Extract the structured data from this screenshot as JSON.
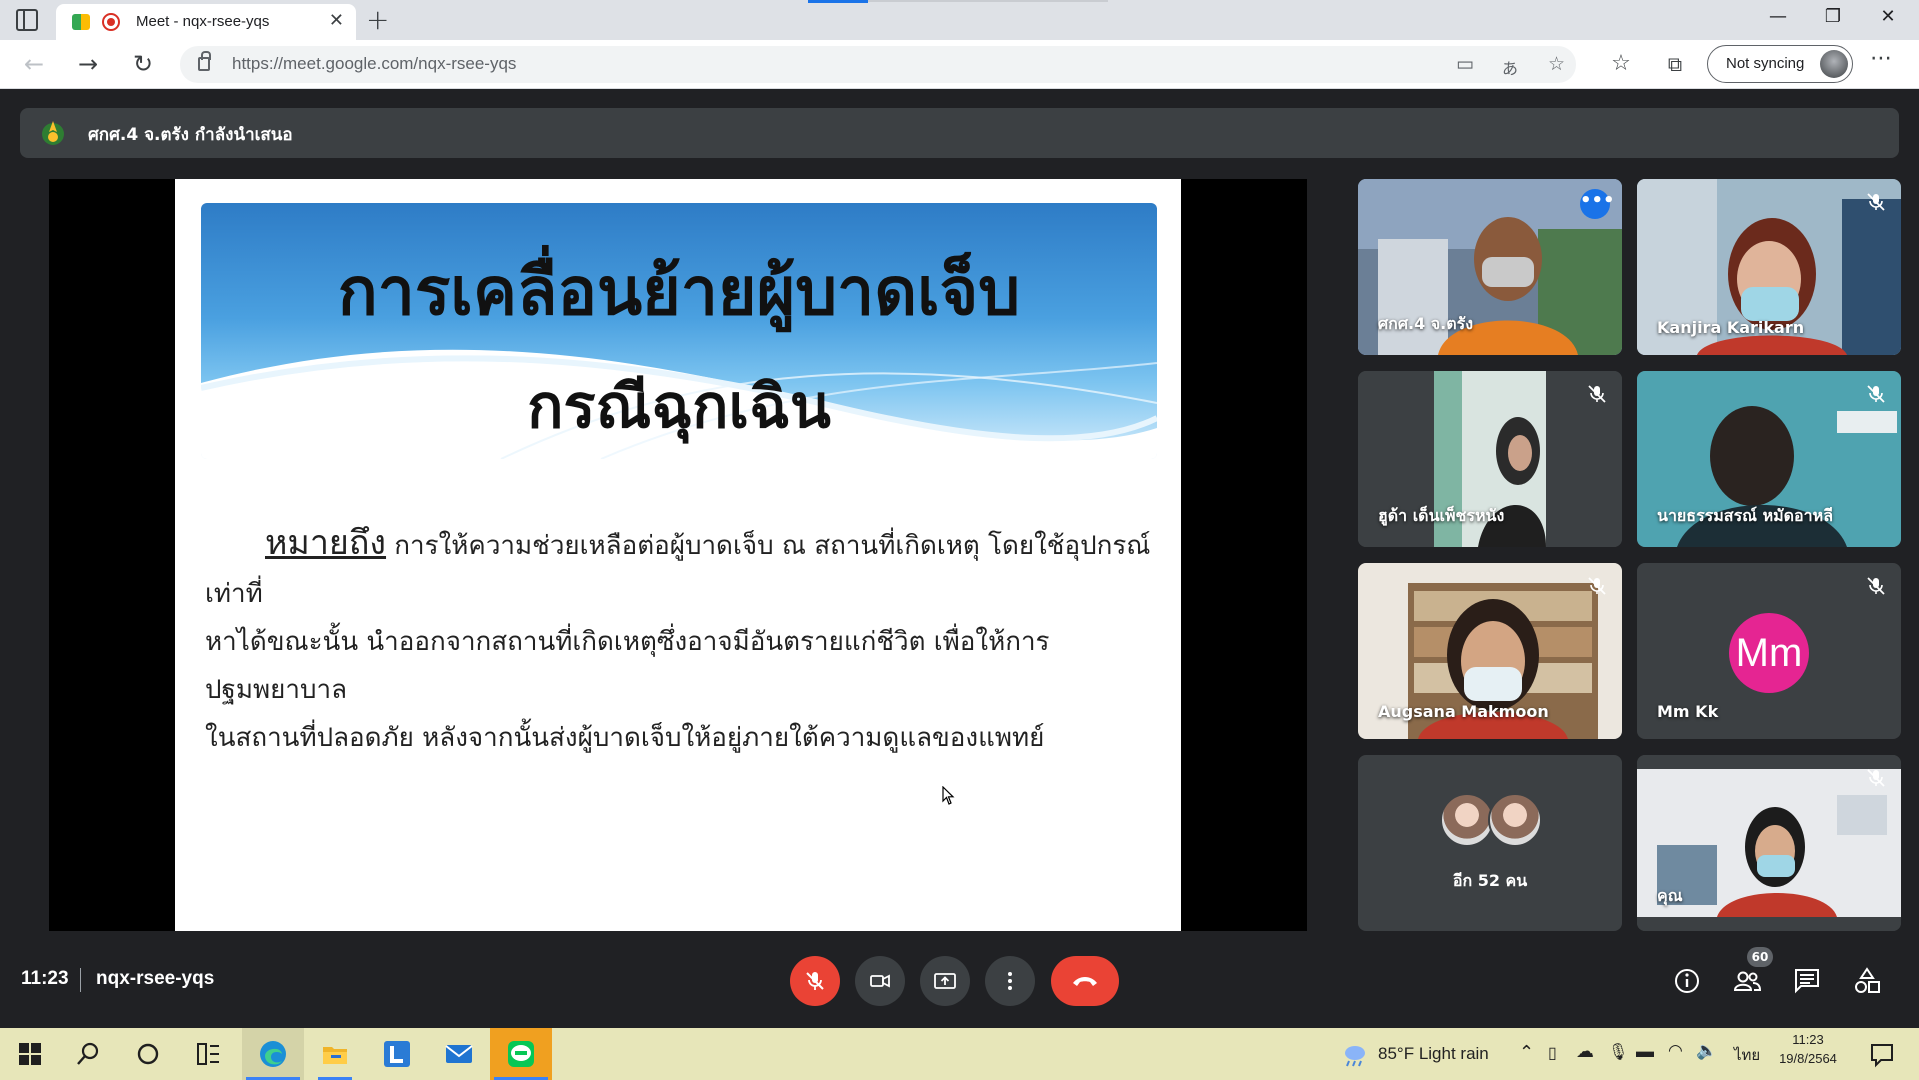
{
  "browser": {
    "tab_title": "Meet - nqx-rsee-yqs",
    "url": "https://meet.google.com/nqx-rsee-yqs",
    "sync_label": "Not syncing"
  },
  "meet": {
    "presenting_text": "ศกศ.4 จ.ตรัง กำลังนำเสนอ",
    "slide": {
      "title_line1": "การเคลื่อนย้ายผู้บาดเจ็บ",
      "title_line2": "กรณีฉุกเฉิน",
      "lead_word": "หมายถึง",
      "body_line1": " การให้ความช่วยเหลือต่อผู้บาดเจ็บ ณ สถานที่เกิดเหตุ โดยใช้อุปกรณ์เท่าที่",
      "body_line2": "หาได้ขณะนั้น นำออกจากสถานที่เกิดเหตุซึ่งอาจมีอันตรายแก่ชีวิต เพื่อให้การปฐมพยาบาล",
      "body_line3": "ในสถานที่ปลอดภัย หลังจากนั้นส่งผู้บาดเจ็บให้อยู่ภายใต้ความดูแลของแพทย์"
    },
    "participants": [
      {
        "name": "ศกศ.4 จ.ตรัง"
      },
      {
        "name": "Kanjira Karikarn"
      },
      {
        "name": "ฮูด้า เด็นเพ็ชรหนัง"
      },
      {
        "name": "นายธรรมสรณ์ หมัดอาหลี"
      },
      {
        "name": "Augsana Makmoon"
      },
      {
        "name": "Mm Kk",
        "initials": "Mm"
      },
      {
        "name": "คุณ"
      }
    ],
    "more_label": "อีก 52 คน",
    "time": "11:23",
    "meeting_code": "nqx-rsee-yqs",
    "people_count": "60"
  },
  "taskbar": {
    "weather": "85°F  Light rain",
    "language": "ไทย",
    "clock_time": "11:23",
    "clock_date": "19/8/2564"
  },
  "colors": {
    "meet_bg": "#202124",
    "tile_bg": "#3c4043",
    "hangup_red": "#ea4335",
    "active_outline": "#8ab4f8",
    "mm_avatar": "#e52592"
  }
}
